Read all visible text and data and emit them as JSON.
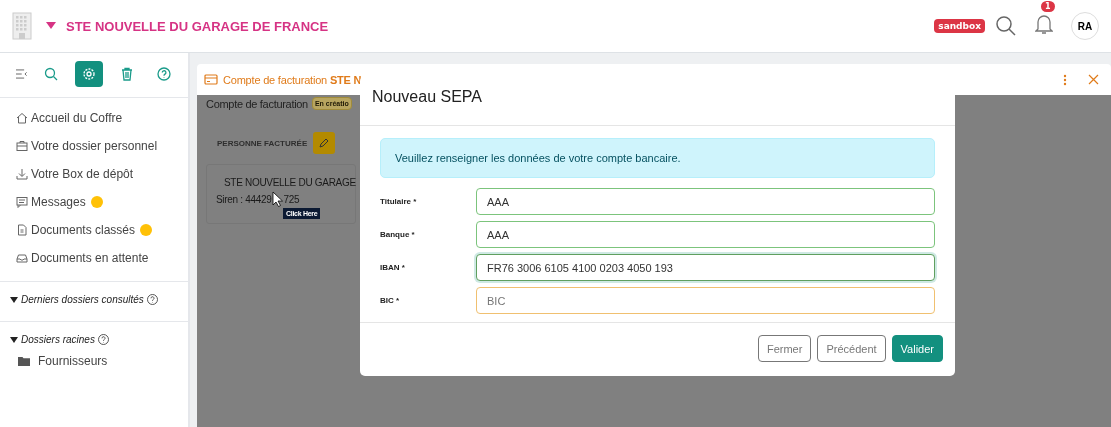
{
  "topbar": {
    "company": "STE NOUVELLE DU GARAGE DE FRANCE",
    "env_badge": "sandbox",
    "notification_count": "1",
    "avatar": "RA"
  },
  "sidebar": {
    "tools": [
      {
        "kind": "search",
        "selected": false
      },
      {
        "kind": "settings",
        "selected": true
      },
      {
        "kind": "trash",
        "selected": false
      },
      {
        "kind": "help",
        "selected": false
      }
    ],
    "items": [
      {
        "kind": "home",
        "label": "Accueil du Coffre",
        "dot": false
      },
      {
        "kind": "briefcase",
        "label": "Votre dossier personnel",
        "dot": false
      },
      {
        "kind": "download",
        "label": "Votre Box de dépôt",
        "dot": false
      },
      {
        "kind": "message",
        "label": "Messages",
        "dot": true
      },
      {
        "kind": "document",
        "label": "Documents classés",
        "dot": true
      },
      {
        "kind": "inbox",
        "label": "Documents en attente",
        "dot": false
      }
    ],
    "sections": [
      {
        "label": "Derniers dossiers consultés",
        "expanded": true
      },
      {
        "label": "Dossiers racines",
        "expanded": true,
        "folders": [
          "Fournisseurs"
        ]
      }
    ]
  },
  "tab": {
    "title": "Compte de facturation",
    "title_bold": "STE N"
  },
  "page": {
    "heading": "Compte de facturation",
    "status_badge": "En créatio",
    "section_label": "PERSONNE FACTURÉE",
    "company": "STE NOUVELLE DU GARAGE",
    "siren_start": "Siren : 44429",
    "siren_end": "725",
    "tooltip": "Click Here"
  },
  "modal": {
    "title": "Nouveau SEPA",
    "info": "Veuillez renseigner les données de votre compte bancaire.",
    "fields": [
      {
        "label": "Titulaire *",
        "value": "AAA",
        "valid": true,
        "focused": false
      },
      {
        "label": "Banque *",
        "value": "AAA",
        "valid": true,
        "focused": false
      },
      {
        "label": "IBAN *",
        "value": "FR76 3006 6105 4100 0203 4050 193",
        "valid": true,
        "focused": true
      },
      {
        "label": "BIC *",
        "placeholder": "BIC",
        "valid": false,
        "focused": false
      }
    ],
    "buttons": [
      {
        "kind": "secondary",
        "label": "Fermer"
      },
      {
        "kind": "secondary",
        "label": "Précédent"
      },
      {
        "kind": "primary",
        "label": "Valider"
      }
    ]
  }
}
